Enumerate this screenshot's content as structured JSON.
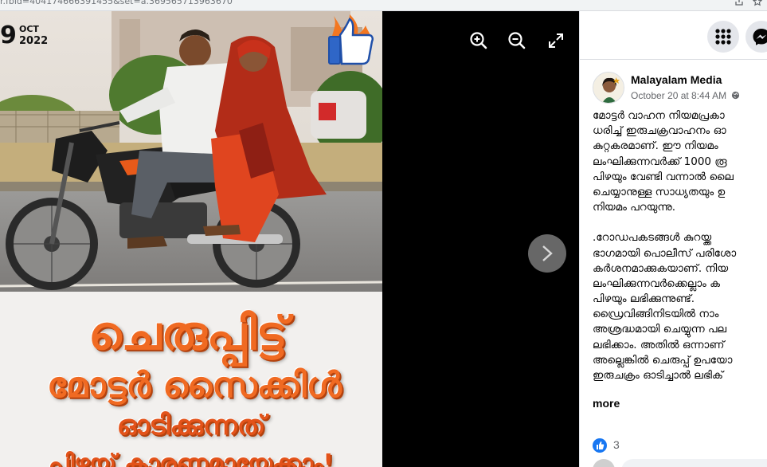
{
  "browser": {
    "url_fragment": "r.fbid=404174666391455&set=a.369565713963670"
  },
  "viewer": {
    "photo": {
      "date_day": "9",
      "date_month": "OCT",
      "date_year": "2022",
      "caption_lines": [
        "ചെരുപ്പിട്ട്",
        "മോട്ടർ സൈക്കിൾ",
        "ഓടിക്കുന്നത്",
        "പിഴയ്ക്ക് കാരണമായേക്കാം!"
      ]
    },
    "icons": {
      "zoom_in": "zoom-in-icon",
      "zoom_out": "zoom-out-icon",
      "fullscreen": "fullscreen-icon",
      "next": "chevron-right-icon"
    }
  },
  "panel": {
    "top_icons": [
      "menu-grid-icon",
      "messenger-icon"
    ],
    "post": {
      "author": "Malayalam Media",
      "timestamp": "October 20 at 8:44 AM",
      "privacy_icon": "globe-icon",
      "paragraphs": [
        [
          "മോട്ടർ വാഹന നിയമപ്രകാ",
          "ധരിച്ച് ഇരുചക്രവാഹനം ഓ",
          "കുറ്റകരമാണ്. ഈ നിയമം",
          "ലംഘിക്കുന്നവർക്ക് 1000 രൂ",
          "പിഴയും വേണ്ടി വന്നാൽ ലൈ",
          "ചെയ്യാനുള്ള സാധ്യതയും ഉ",
          "നിയമം പറയുന്നു."
        ],
        [
          ".റോഡപകടങ്ങൾ കുറയ്ക്ക",
          "ഭാഗമായി പൊലീസ് പരിശോ",
          "കർശനമാക്കുകയാണ്. നിയ",
          "ലംഘിക്കുന്നവർക്കെല്ലാം ക",
          "പിഴയും ലഭിക്കുന്നുണ്ട്.",
          "ഡ്രൈവിങ്ങിനിടയിൽ നാം",
          "അശ്രദ്ധമായി ചെയ്യുന്ന പല",
          "ലഭിക്കാം. അതിൽ ഒന്നാണ്",
          "അല്ലെങ്കിൽ ചെരുപ്പ് ഉപയോ",
          "ഇരുചക്രം ഓടിച്ചാൽ ലഭിക്"
        ]
      ],
      "more_label": "more",
      "like_count": "3"
    }
  },
  "colors": {
    "caption_orange": "#f06a22",
    "facebook_blue": "#1877f2",
    "viewer_bg": "#000000"
  }
}
